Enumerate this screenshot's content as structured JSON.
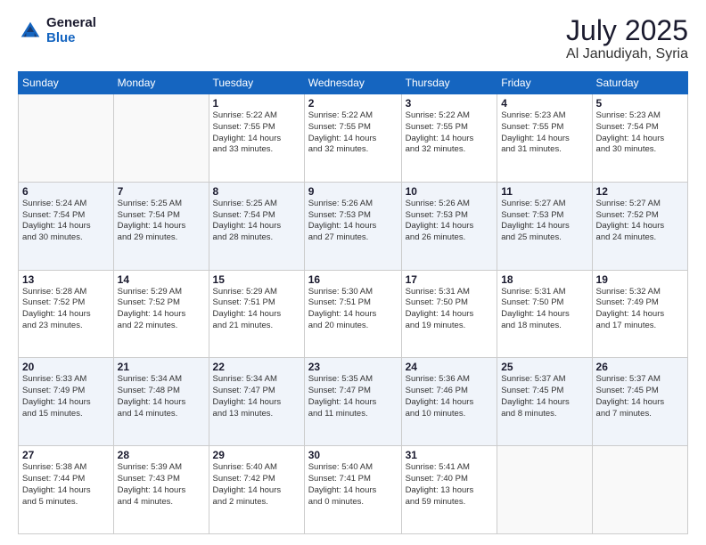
{
  "logo": {
    "general": "General",
    "blue": "Blue"
  },
  "header": {
    "month_year": "July 2025",
    "location": "Al Janudiyah, Syria"
  },
  "weekdays": [
    "Sunday",
    "Monday",
    "Tuesday",
    "Wednesday",
    "Thursday",
    "Friday",
    "Saturday"
  ],
  "weeks": [
    [
      {
        "day": "",
        "info": ""
      },
      {
        "day": "",
        "info": ""
      },
      {
        "day": "1",
        "info": "Sunrise: 5:22 AM\nSunset: 7:55 PM\nDaylight: 14 hours\nand 33 minutes."
      },
      {
        "day": "2",
        "info": "Sunrise: 5:22 AM\nSunset: 7:55 PM\nDaylight: 14 hours\nand 32 minutes."
      },
      {
        "day": "3",
        "info": "Sunrise: 5:22 AM\nSunset: 7:55 PM\nDaylight: 14 hours\nand 32 minutes."
      },
      {
        "day": "4",
        "info": "Sunrise: 5:23 AM\nSunset: 7:55 PM\nDaylight: 14 hours\nand 31 minutes."
      },
      {
        "day": "5",
        "info": "Sunrise: 5:23 AM\nSunset: 7:54 PM\nDaylight: 14 hours\nand 30 minutes."
      }
    ],
    [
      {
        "day": "6",
        "info": "Sunrise: 5:24 AM\nSunset: 7:54 PM\nDaylight: 14 hours\nand 30 minutes."
      },
      {
        "day": "7",
        "info": "Sunrise: 5:25 AM\nSunset: 7:54 PM\nDaylight: 14 hours\nand 29 minutes."
      },
      {
        "day": "8",
        "info": "Sunrise: 5:25 AM\nSunset: 7:54 PM\nDaylight: 14 hours\nand 28 minutes."
      },
      {
        "day": "9",
        "info": "Sunrise: 5:26 AM\nSunset: 7:53 PM\nDaylight: 14 hours\nand 27 minutes."
      },
      {
        "day": "10",
        "info": "Sunrise: 5:26 AM\nSunset: 7:53 PM\nDaylight: 14 hours\nand 26 minutes."
      },
      {
        "day": "11",
        "info": "Sunrise: 5:27 AM\nSunset: 7:53 PM\nDaylight: 14 hours\nand 25 minutes."
      },
      {
        "day": "12",
        "info": "Sunrise: 5:27 AM\nSunset: 7:52 PM\nDaylight: 14 hours\nand 24 minutes."
      }
    ],
    [
      {
        "day": "13",
        "info": "Sunrise: 5:28 AM\nSunset: 7:52 PM\nDaylight: 14 hours\nand 23 minutes."
      },
      {
        "day": "14",
        "info": "Sunrise: 5:29 AM\nSunset: 7:52 PM\nDaylight: 14 hours\nand 22 minutes."
      },
      {
        "day": "15",
        "info": "Sunrise: 5:29 AM\nSunset: 7:51 PM\nDaylight: 14 hours\nand 21 minutes."
      },
      {
        "day": "16",
        "info": "Sunrise: 5:30 AM\nSunset: 7:51 PM\nDaylight: 14 hours\nand 20 minutes."
      },
      {
        "day": "17",
        "info": "Sunrise: 5:31 AM\nSunset: 7:50 PM\nDaylight: 14 hours\nand 19 minutes."
      },
      {
        "day": "18",
        "info": "Sunrise: 5:31 AM\nSunset: 7:50 PM\nDaylight: 14 hours\nand 18 minutes."
      },
      {
        "day": "19",
        "info": "Sunrise: 5:32 AM\nSunset: 7:49 PM\nDaylight: 14 hours\nand 17 minutes."
      }
    ],
    [
      {
        "day": "20",
        "info": "Sunrise: 5:33 AM\nSunset: 7:49 PM\nDaylight: 14 hours\nand 15 minutes."
      },
      {
        "day": "21",
        "info": "Sunrise: 5:34 AM\nSunset: 7:48 PM\nDaylight: 14 hours\nand 14 minutes."
      },
      {
        "day": "22",
        "info": "Sunrise: 5:34 AM\nSunset: 7:47 PM\nDaylight: 14 hours\nand 13 minutes."
      },
      {
        "day": "23",
        "info": "Sunrise: 5:35 AM\nSunset: 7:47 PM\nDaylight: 14 hours\nand 11 minutes."
      },
      {
        "day": "24",
        "info": "Sunrise: 5:36 AM\nSunset: 7:46 PM\nDaylight: 14 hours\nand 10 minutes."
      },
      {
        "day": "25",
        "info": "Sunrise: 5:37 AM\nSunset: 7:45 PM\nDaylight: 14 hours\nand 8 minutes."
      },
      {
        "day": "26",
        "info": "Sunrise: 5:37 AM\nSunset: 7:45 PM\nDaylight: 14 hours\nand 7 minutes."
      }
    ],
    [
      {
        "day": "27",
        "info": "Sunrise: 5:38 AM\nSunset: 7:44 PM\nDaylight: 14 hours\nand 5 minutes."
      },
      {
        "day": "28",
        "info": "Sunrise: 5:39 AM\nSunset: 7:43 PM\nDaylight: 14 hours\nand 4 minutes."
      },
      {
        "day": "29",
        "info": "Sunrise: 5:40 AM\nSunset: 7:42 PM\nDaylight: 14 hours\nand 2 minutes."
      },
      {
        "day": "30",
        "info": "Sunrise: 5:40 AM\nSunset: 7:41 PM\nDaylight: 14 hours\nand 0 minutes."
      },
      {
        "day": "31",
        "info": "Sunrise: 5:41 AM\nSunset: 7:40 PM\nDaylight: 13 hours\nand 59 minutes."
      },
      {
        "day": "",
        "info": ""
      },
      {
        "day": "",
        "info": ""
      }
    ]
  ]
}
